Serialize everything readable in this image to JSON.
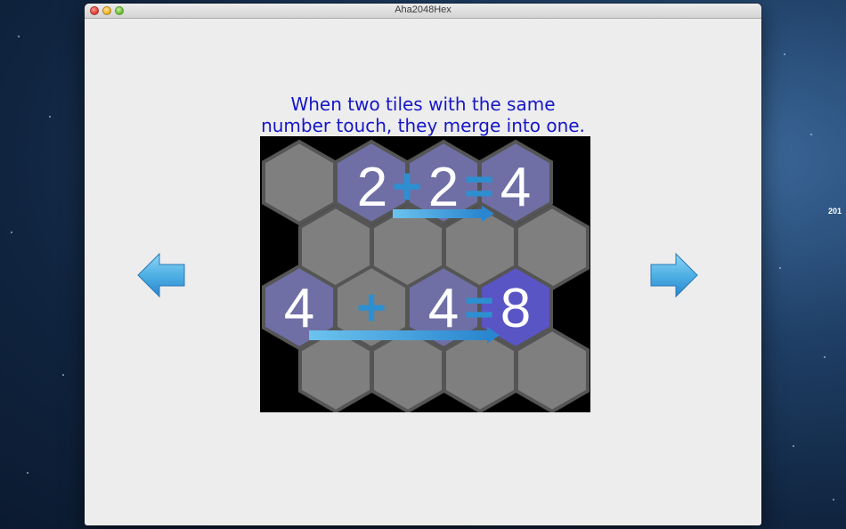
{
  "window": {
    "title": "Aha2048Hex"
  },
  "desktop": {
    "clipped_text": "201"
  },
  "tutorial": {
    "line1": "When two tiles with the same",
    "line2": "number touch, they merge into one."
  },
  "board": {
    "eq1": {
      "a": "2",
      "op": "+",
      "b": "2",
      "eq": "=",
      "result": "4"
    },
    "eq2": {
      "a": "4",
      "op": "+",
      "b": "4",
      "eq": "=",
      "result": "8"
    }
  },
  "nav": {
    "prev_icon": "left-arrow-icon",
    "next_icon": "right-arrow-icon"
  },
  "colors": {
    "instruction_text": "#1616c8",
    "empty_tile": "#7f7f7f",
    "tile_2": "#6f6fa6",
    "tile_8": "#5a55c4",
    "operator": "#2e8fd0",
    "arrow": "#48a9e2"
  }
}
